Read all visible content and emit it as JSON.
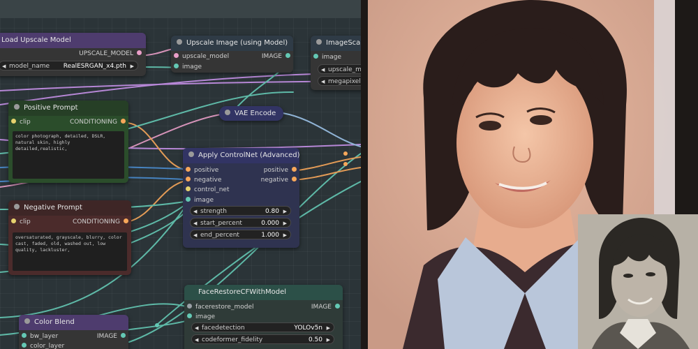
{
  "colors": {
    "conditioning": "#f7a75a",
    "image": "#64c8b4",
    "model": "#e99ec8",
    "control_net": "#e6d26e",
    "float": "#b4b4b4",
    "positive_node": "#2b4d2b",
    "negative_node": "#4b2b2b",
    "purple_node": "#4e3c6e",
    "vae_node": "#323464",
    "green_node": "#2c5048"
  },
  "nodes": {
    "load_upscale": {
      "title": "Load Upscale Model",
      "output": "UPSCALE_MODEL",
      "widget": {
        "label": "model_name",
        "value": "RealESRGAN_x4.pth"
      }
    },
    "upscale_image": {
      "title": "Upscale Image (using Model)",
      "inputs": [
        "upscale_model",
        "image"
      ],
      "output": "IMAGE"
    },
    "image_scale": {
      "title": "ImageScale",
      "input": "image",
      "widgets": [
        "upscale_me",
        "megapixels"
      ]
    },
    "positive_prompt": {
      "title": "Positive Prompt",
      "input": "clip",
      "output": "CONDITIONING",
      "text": "color photograph, detailed, DSLR, natural skin, highly detailed,realistic,"
    },
    "negative_prompt": {
      "title": "Negative Prompt",
      "input": "clip",
      "output": "CONDITIONING",
      "text": "oversaturated, grayscale, blurry, color cast, faded, old, washed out, low quality, lackluster,"
    },
    "vae_encode": {
      "title": "VAE Encode"
    },
    "apply_controlnet": {
      "title": "Apply ControlNet (Advanced)",
      "inputs": [
        "positive",
        "negative",
        "control_net",
        "image"
      ],
      "outputs": [
        "positive",
        "negative"
      ],
      "widgets": [
        {
          "label": "strength",
          "value": "0.80"
        },
        {
          "label": "start_percent",
          "value": "0.000"
        },
        {
          "label": "end_percent",
          "value": "1.000"
        }
      ]
    },
    "face_restore": {
      "title": "FaceRestoreCFWithModel",
      "inputs": [
        "facerestore_model",
        "image"
      ],
      "output": "IMAGE",
      "widgets": [
        {
          "label": "facedetection",
          "value": "YOLOv5n"
        },
        {
          "label": "codeformer_fidelity",
          "value": "0.50"
        }
      ]
    },
    "color_blend": {
      "title": "Color Blend",
      "inputs": [
        "bw_layer",
        "color_layer"
      ],
      "output": "IMAGE"
    }
  }
}
